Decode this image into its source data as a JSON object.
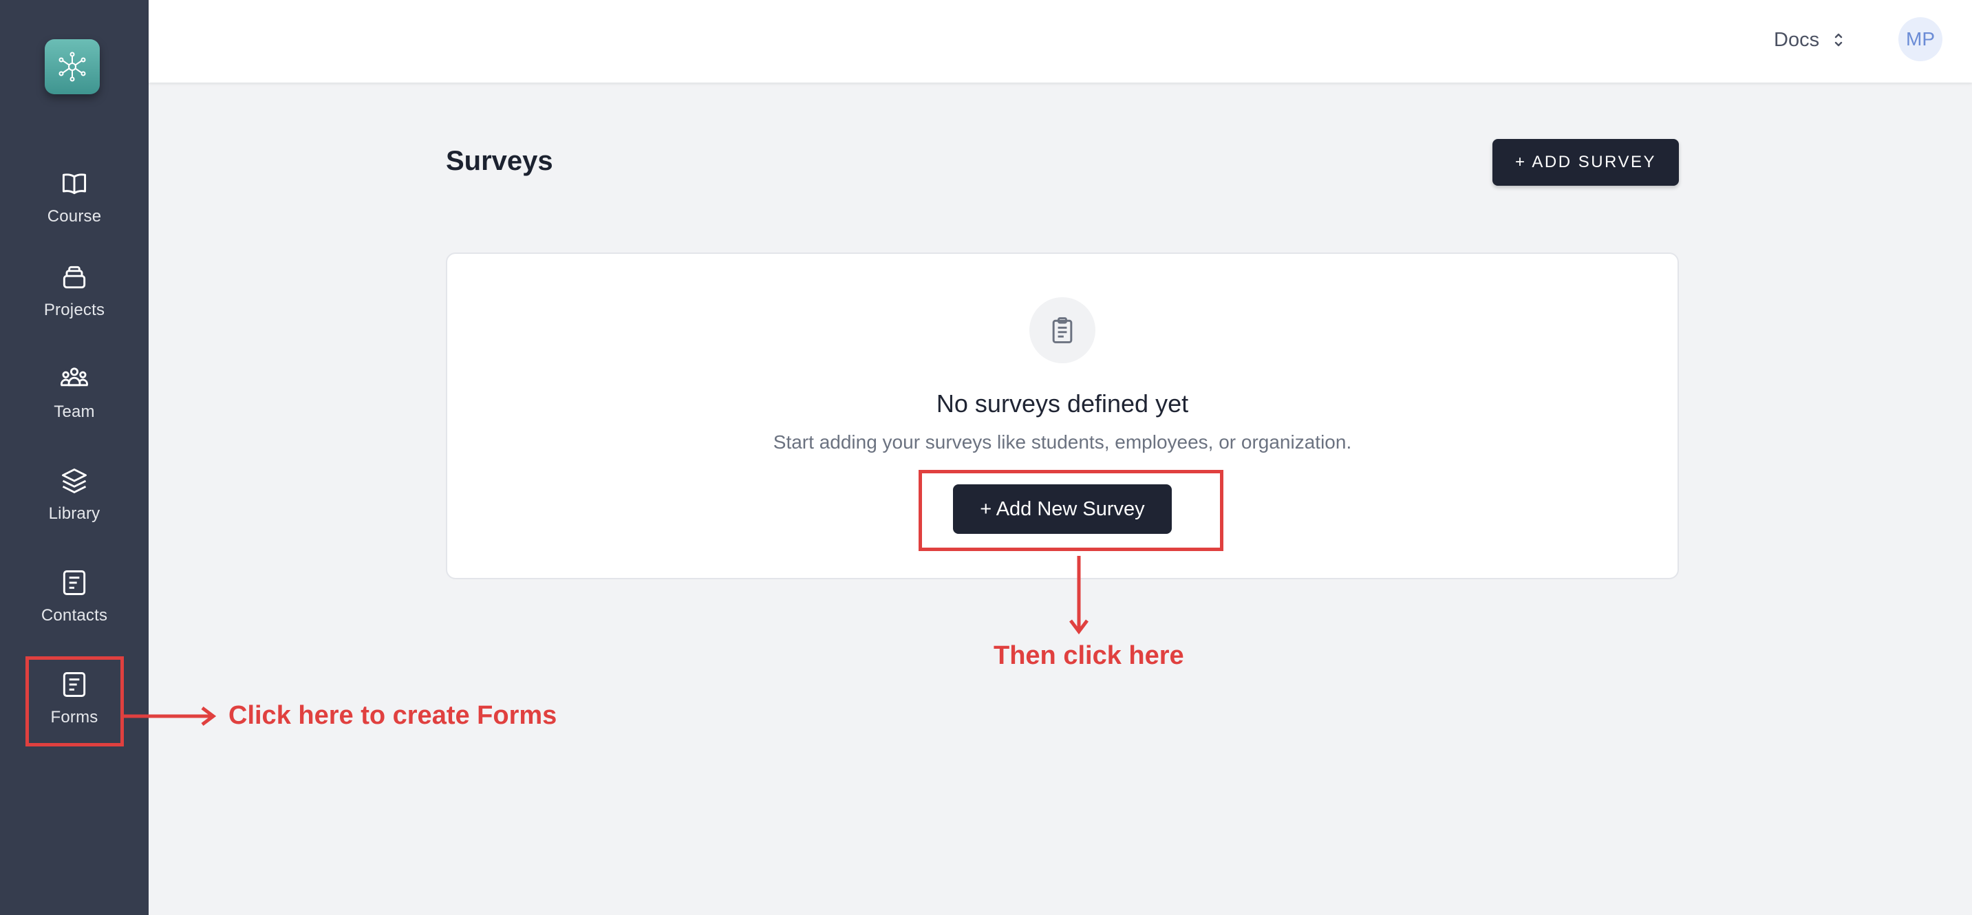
{
  "sidebar": {
    "items": [
      {
        "label": "Course",
        "icon": "book-open-icon"
      },
      {
        "label": "Projects",
        "icon": "stack-box-icon"
      },
      {
        "label": "Team",
        "icon": "team-icon"
      },
      {
        "label": "Library",
        "icon": "layers-icon"
      },
      {
        "label": "Contacts",
        "icon": "document-icon"
      },
      {
        "label": "Forms",
        "icon": "document-icon"
      }
    ]
  },
  "header": {
    "docs_label": "Docs",
    "avatar_initials": "MP"
  },
  "main": {
    "title": "Surveys",
    "add_button_label": "+ ADD SURVEY",
    "empty_state": {
      "title": "No surveys defined yet",
      "subtitle": "Start adding your surveys like students, employees, or organization.",
      "button_label": "+ Add New Survey"
    }
  },
  "annotations": {
    "forms_hint": "Click here to create Forms",
    "button_hint": "Then click here",
    "color": "#e0403f"
  },
  "colors": {
    "sidebar_bg": "#363d4e",
    "button_bg": "#1f2433",
    "logo_accent": "#4fa8a1"
  }
}
